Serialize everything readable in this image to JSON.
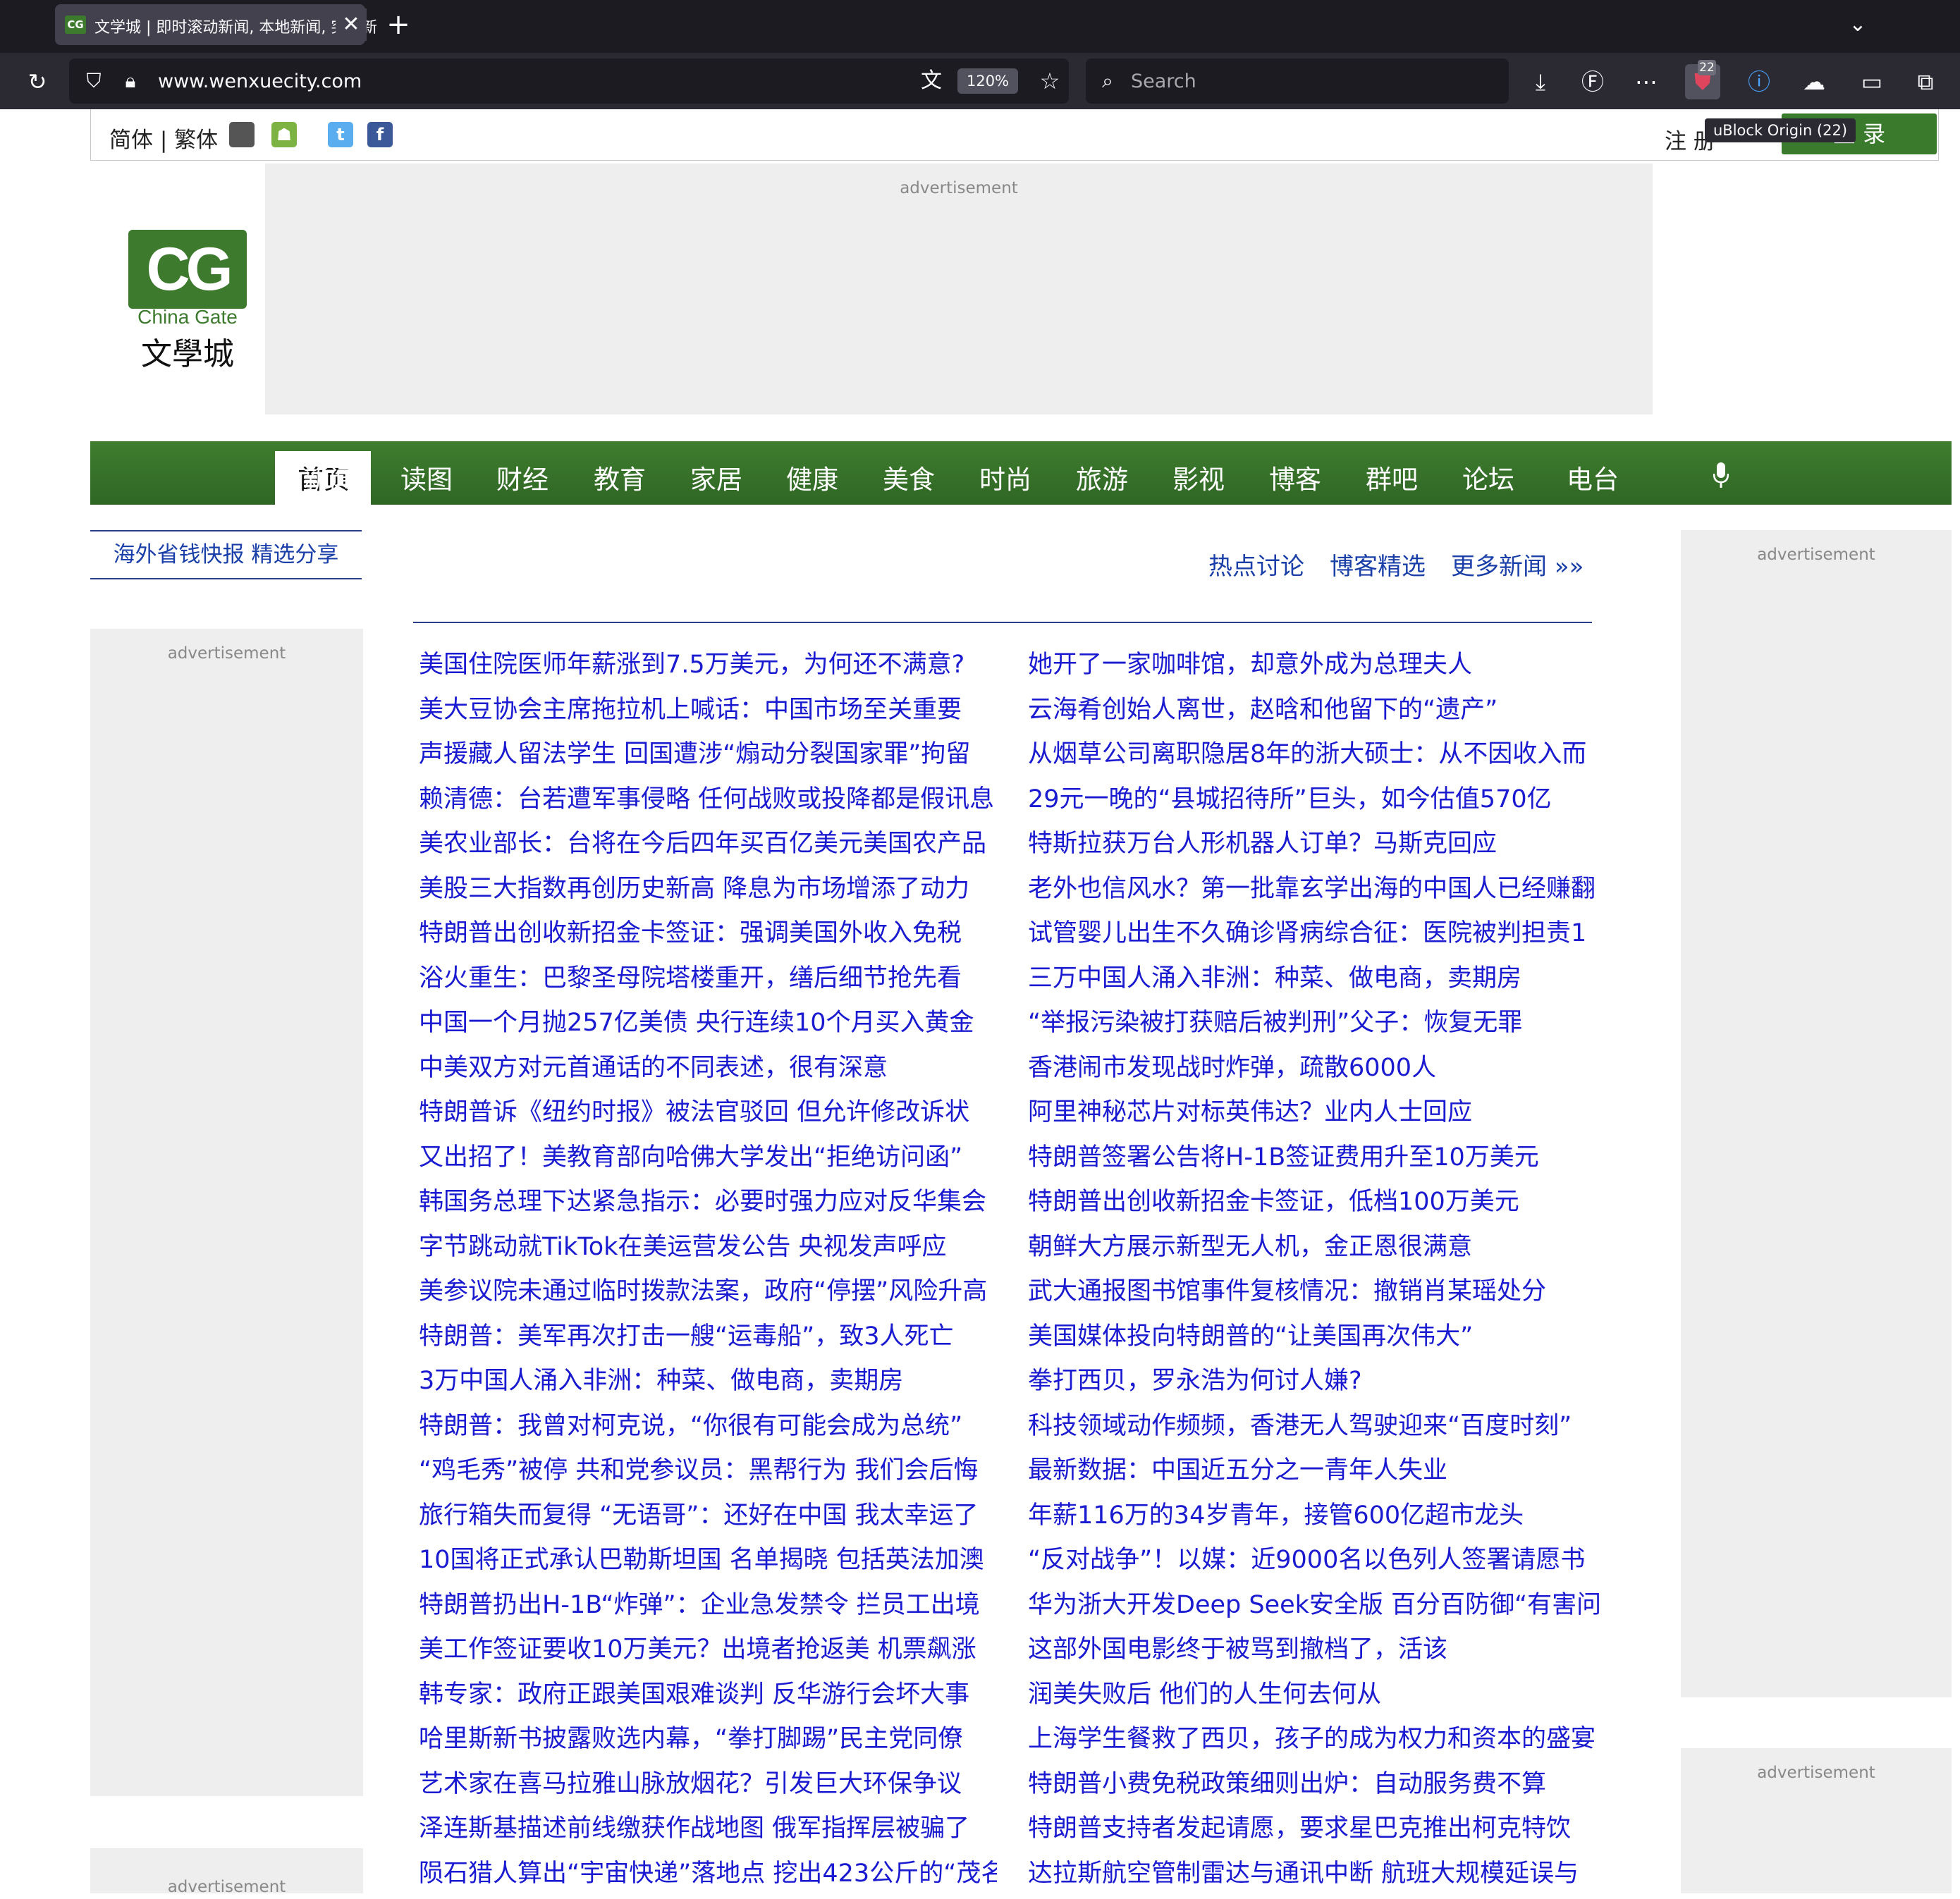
{
  "browser": {
    "tab_title": "文学城 | 即时滚动新闻, 本地新闻, 突发新闻",
    "tab_favicon": "CG",
    "url": "www.wenxuecity.com",
    "zoom": "120%",
    "search_placeholder": "Search",
    "ublock_count": "22",
    "ublock_tooltip": "uBlock Origin (22)"
  },
  "header": {
    "lang_switch": "简体 | 繁体",
    "register": "注 册",
    "login": "登 录",
    "ad_label": "advertisement"
  },
  "logo": {
    "mark": "CG",
    "en": "China Gate",
    "cn": "文學城"
  },
  "nav": {
    "active": "首页",
    "items": [
      "新闻",
      "读图",
      "财经",
      "教育",
      "家居",
      "健康",
      "美食",
      "时尚",
      "旅游",
      "影视",
      "博客",
      "群吧",
      "论坛",
      "电台"
    ]
  },
  "sidebar": {
    "deals_link": "海外省钱快报 精选分享",
    "ad_label": "advertisement"
  },
  "main": {
    "links": [
      "热点讨论",
      "博客精选",
      "更多新闻 »»"
    ],
    "left_news": [
      "美国住院医师年薪涨到7.5万美元，为何还不满意?",
      "美大豆协会主席拖拉机上喊话：中国市场至关重要",
      "声援藏人留法学生 回国遭涉“煽动分裂国家罪”拘留",
      "赖清德：台若遭军事侵略 任何战败或投降都是假讯息",
      "美农业部长：台将在今后四年买百亿美元美国农产品",
      "美股三大指数再创历史新高 降息为市场增添了动力",
      "特朗普出创收新招金卡签证：强调美国外收入免税",
      "浴火重生：巴黎圣母院塔楼重开，缮后细节抢先看",
      "中国一个月抛257亿美债 央行连续10个月买入黄金",
      "中美双方对元首通话的不同表述，很有深意",
      "特朗普诉《纽约时报》被法官驳回 但允许修改诉状",
      "又出招了！美教育部向哈佛大学发出“拒绝访问函”",
      "韩国务总理下达紧急指示：必要时强力应对反华集会",
      "字节跳动就TikTok在美运营发公告 央视发声呼应",
      "美参议院未通过临时拨款法案，政府“停摆”风险升高",
      "特朗普：美军再次打击一艘“运毒船”，致3人死亡",
      "3万中国人涌入非洲：种菜、做电商，卖期房",
      "特朗普：我曾对柯克说，“你很有可能会成为总统”",
      "“鸡毛秀”被停 共和党参议员：黑帮行为 我们会后悔",
      "旅行箱失而复得 “无语哥”：还好在中国 我太幸运了",
      "10国将正式承认巴勒斯坦国 名单揭晓 包括英法加澳",
      "特朗普扔出H-1B“炸弹”：企业急发禁令 拦员工出境",
      "美工作签证要收10万美元？出境者抢返美 机票飙涨",
      "韩专家：政府正跟美国艰难谈判 反华游行会坏大事",
      "哈里斯新书披露败选内幕，“拳打脚踢”民主党同僚",
      "艺术家在喜马拉雅山脉放烟花？引发巨大环保争议",
      "泽连斯基描述前线缴获作战地图 俄军指挥层被骗了",
      "陨石猎人算出“宇宙快递”落地点 挖出423公斤的“茂名"
    ],
    "right_news": [
      "她开了一家咖啡馆，却意外成为总理夫人",
      "云海肴创始人离世，赵晗和他留下的“遗产”",
      "从烟草公司离职隐居8年的浙大硕士：从不因收入而",
      "29元一晚的“县城招待所”巨头，如今估值570亿",
      "特斯拉获万台人形机器人订单？马斯克回应",
      "老外也信风水？第一批靠玄学出海的中国人已经赚翻",
      "试管婴儿出生不久确诊肾病综合征：医院被判担责1",
      "三万中国人涌入非洲：种菜、做电商，卖期房",
      "“举报污染被打获赔后被判刑”父子：恢复无罪",
      "香港闹市发现战时炸弹，疏散6000人",
      "阿里神秘芯片对标英伟达？业内人士回应",
      "特朗普签署公告将H-1B签证费用升至10万美元",
      "特朗普出创收新招金卡签证，低档100万美元",
      "朝鲜大方展示新型无人机，金正恩很满意",
      "武大通报图书馆事件复核情况：撤销肖某瑶处分",
      "美国媒体投向特朗普的“让美国再次伟大”",
      "拳打西贝，罗永浩为何讨人嫌?",
      "科技领域动作频频，香港无人驾驶迎来“百度时刻”",
      "最新数据：中国近五分之一青年人失业",
      "年薪116万的34岁青年，接管600亿超市龙头",
      "“反对战争”！以媒：近9000名以色列人签署请愿书",
      "华为浙大开发Deep Seek安全版 百分百防御“有害问",
      "这部外国电影终于被骂到撤档了，活该",
      "润美失败后 他们的人生何去何从",
      "上海学生餐救了西贝，孩子的成为权力和资本的盛宴",
      "特朗普小费免税政策细则出炉：自动服务费不算",
      "特朗普支持者发起请愿，要求星巴克推出柯克特饮",
      "达拉斯航空管制雷达与通讯中断 航班大规模延误与"
    ]
  },
  "colors": {
    "nav_green": "#3a7a2c",
    "link_blue": "#1a1ad0",
    "rule_blue": "#2b3c8a"
  }
}
